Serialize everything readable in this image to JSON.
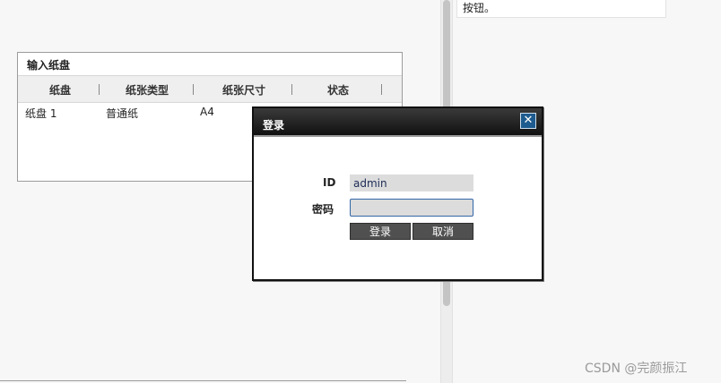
{
  "right_panel": {
    "note_text": "按钮。"
  },
  "tray_panel": {
    "title": "输入纸盘",
    "columns": [
      "纸盘",
      "纸张类型",
      "纸张尺寸",
      "状态"
    ],
    "rows": [
      [
        "纸盘 1",
        "普通纸",
        "A4",
        ""
      ]
    ]
  },
  "login_dialog": {
    "title": "登录",
    "close_icon": "close-icon",
    "id_label": "ID",
    "id_value": "admin",
    "password_label": "密码",
    "password_value": "",
    "login_button": "登录",
    "cancel_button": "取消",
    "accent_color": "#1e5b8e"
  },
  "watermark": "CSDN @完颜振江"
}
